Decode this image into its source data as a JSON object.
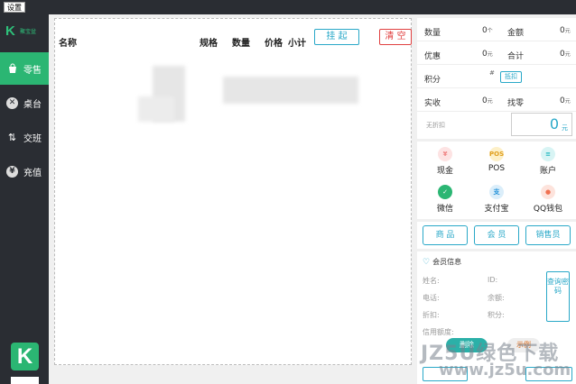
{
  "topbar": {
    "settings_label": "设置"
  },
  "sidebar": {
    "logo_text": "聚宝盆",
    "logo_letter": "K",
    "items": [
      {
        "label": "零售",
        "icon": "bag-icon"
      },
      {
        "label": "桌台",
        "icon": "close-circle-icon"
      },
      {
        "label": "交班",
        "icon": "swap-icon"
      },
      {
        "label": "充值",
        "icon": "yen-circle-icon"
      }
    ],
    "bottom_logo_letter": "K"
  },
  "cart": {
    "headers": {
      "name": "名称",
      "spec": "规格",
      "qty": "数量",
      "price": "价格",
      "subtotal": "小计"
    },
    "hang_label": "挂 起",
    "clear_label": "清 空"
  },
  "summary": {
    "qty_label": "数量",
    "qty_value": "0",
    "qty_unit": "个",
    "amount_label": "金额",
    "amount_value": "0",
    "amount_unit": "元",
    "discount_label": "优惠",
    "discount_value": "0",
    "discount_unit": "元",
    "total_label": "合计",
    "total_value": "0",
    "total_unit": "元",
    "points_label": "积分",
    "points_hash": "#",
    "redeem_label": "抵扣",
    "received_label": "实收",
    "received_value": "0",
    "received_unit": "元",
    "change_label": "找零",
    "change_value": "0",
    "change_unit": "元",
    "no_discount_label": "无折扣",
    "big_value": "0",
    "big_unit": "元"
  },
  "payments": [
    {
      "label": "现金",
      "glyph": "¥",
      "color": "#f08080",
      "bg": "#fde3e3"
    },
    {
      "label": "POS",
      "glyph": "POS",
      "color": "#e0a020",
      "bg": "#fdf0c8"
    },
    {
      "label": "账户",
      "glyph": "≡",
      "color": "#20b8c0",
      "bg": "#d8f4f4"
    },
    {
      "label": "微信",
      "glyph": "✓",
      "color": "#ffffff",
      "bg": "#2bb673"
    },
    {
      "label": "支付宝",
      "glyph": "支",
      "color": "#2090d8",
      "bg": "#dbeefa"
    },
    {
      "label": "QQ钱包",
      "glyph": "●",
      "color": "#f07050",
      "bg": "#fde3dc"
    }
  ],
  "tabs": {
    "goods": "商 品",
    "member": "会 员",
    "seller": "销售员"
  },
  "member": {
    "title": "会员信息",
    "name_label": "姓名:",
    "id_label": "ID:",
    "phone_label": "电话:",
    "balance_label": "余额:",
    "discount_label": "折扣:",
    "points_label": "积分:",
    "credit_label": "信用额度:",
    "query_label": "查询密码",
    "delete_label": "删除",
    "watermark_btn": "示例"
  },
  "watermark": {
    "line1": "JZ5U绿色下载",
    "line2": "www.jz5u.com"
  }
}
